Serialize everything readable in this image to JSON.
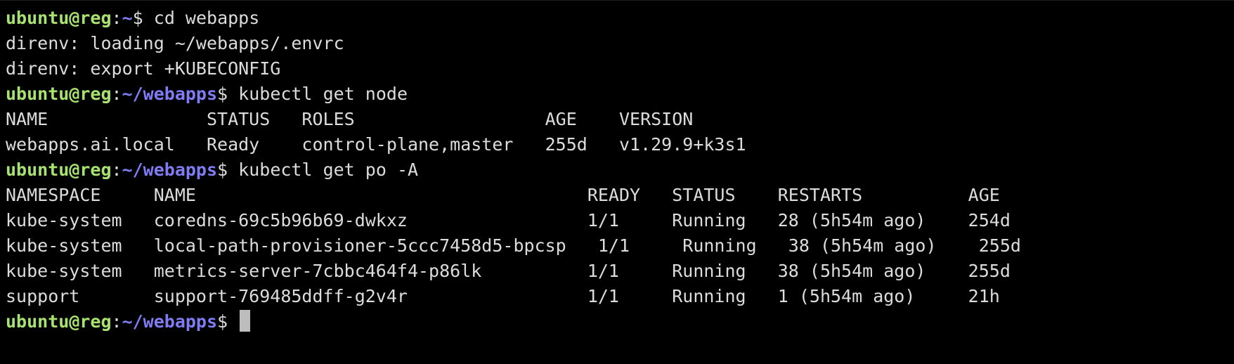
{
  "colors": {
    "background": "#000000",
    "text": "#dcdcdc",
    "prompt_user": "#a8e26f",
    "prompt_path": "#7f7cf4",
    "cursor": "#bdbdbd"
  },
  "prompt": {
    "user_host": "ubuntu@reg",
    "separator": ":",
    "home_path": "~",
    "webapps_path": "~/webapps",
    "symbol": "$"
  },
  "session": {
    "cmd_cd": "cd webapps",
    "direnv_loading": "direnv: loading ~/webapps/.envrc",
    "direnv_export": "direnv: export +KUBECONFIG",
    "cmd_get_node": "kubectl get node",
    "cmd_get_pods": "kubectl get po -A"
  },
  "nodes_table": {
    "header": "NAME               STATUS   ROLES                  AGE    VERSION",
    "rows": [
      "webapps.ai.local   Ready    control-plane,master   255d   v1.29.9+k3s1"
    ]
  },
  "pods_table": {
    "header": "NAMESPACE     NAME                                     READY   STATUS    RESTARTS          AGE",
    "rows": [
      "kube-system   coredns-69c5b96b69-dwkxz                 1/1     Running   28 (5h54m ago)    254d",
      "kube-system   local-path-provisioner-5ccc7458d5-bpcsp   1/1     Running   38 (5h54m ago)    255d",
      "kube-system   metrics-server-7cbbc464f4-p86lk          1/1     Running   38 (5h54m ago)    255d",
      "support       support-769485ddff-g2v4r                 1/1     Running   1 (5h54m ago)     21h"
    ]
  }
}
